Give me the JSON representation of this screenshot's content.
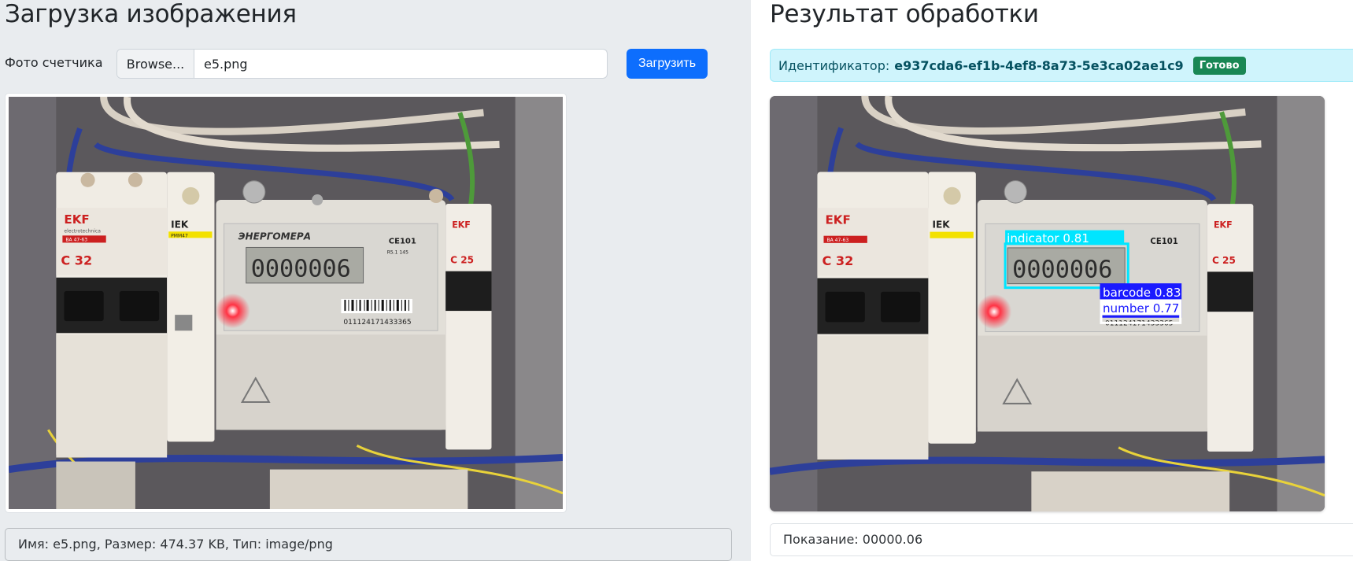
{
  "upload": {
    "title": "Загрузка изображения",
    "field_label": "Фото счетчика",
    "browse_label": "Browse...",
    "file_name": "e5.png",
    "submit_label": "Загрузить",
    "file_info": "Имя: e5.png, Размер: 474.37 KB, Тип: image/png"
  },
  "result": {
    "title": "Результат обработки",
    "id_label": "Идентификатор:",
    "id_value": "e937cda6-ef1b-4ef8-8a73-5e3ca02ae1c9",
    "status_badge": "Готово",
    "reading": "Показание: 00000.06"
  },
  "photo_text": {
    "ekf_brand": "EKF",
    "ekf_sub": "electrotechnica",
    "ekf_model": "BA 47-63",
    "breaker_rating": "C 32",
    "iek_brand": "IEK",
    "iek_model": "PMM47",
    "meter_brand": "ЭНЕРГОМЕРА",
    "meter_model": "CE101",
    "meter_sub": "R5.1 145",
    "display_digits": "0000006",
    "serial": "011124171433365",
    "right_breaker_rating": "C 25",
    "right_ekf": "EKF"
  },
  "detections": [
    {
      "label": "indicator 0.81",
      "color": "#00e5ff"
    },
    {
      "label": "barcode 0.83",
      "color": "#1a1aff"
    },
    {
      "label": "number 0.77",
      "color": "#ffffff"
    }
  ],
  "colors": {
    "primary": "#0d6efd",
    "success": "#198754",
    "info_bg": "#cff4fc",
    "info_text": "#055160"
  }
}
